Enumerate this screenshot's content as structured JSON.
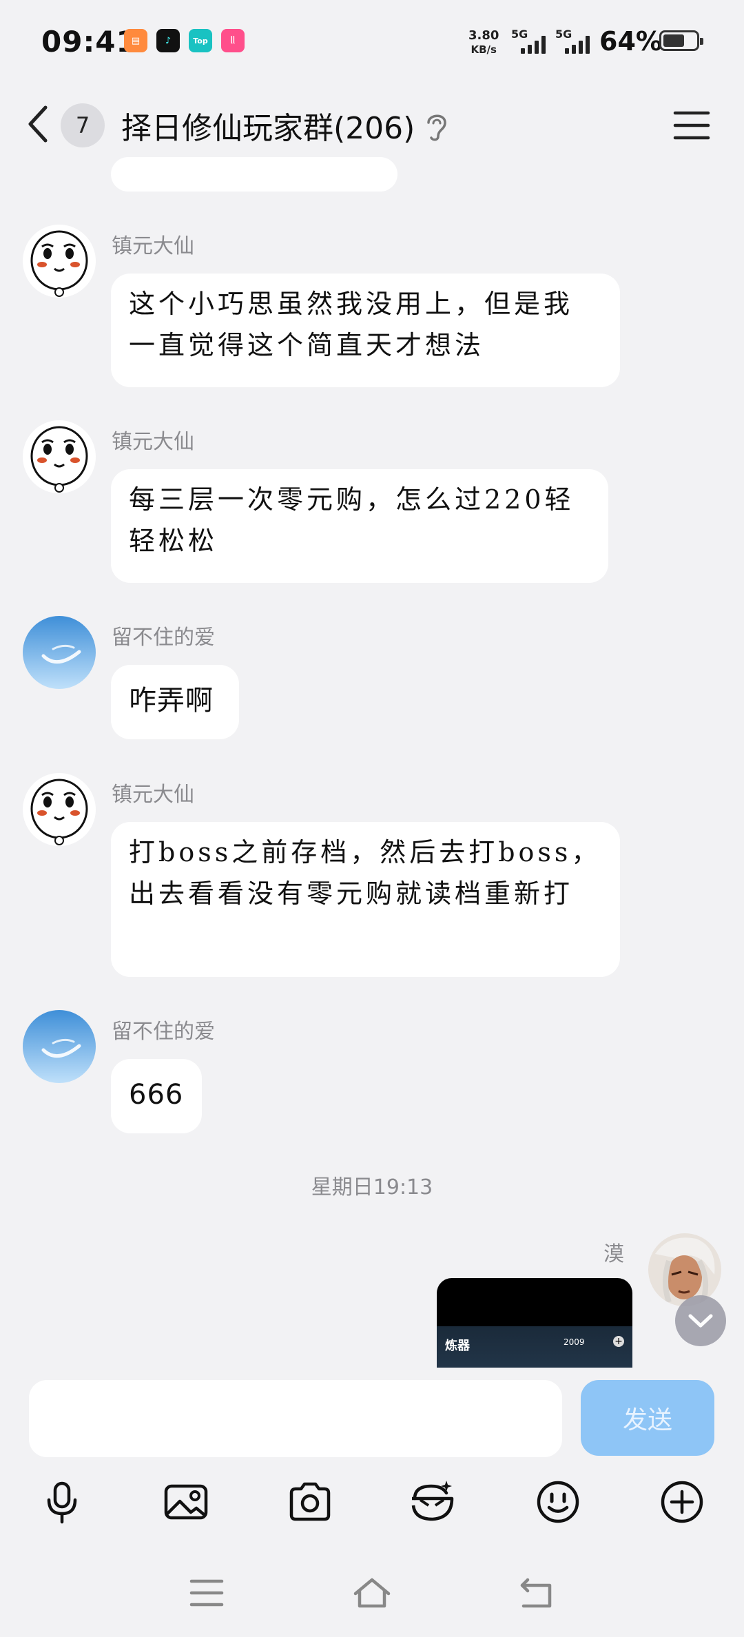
{
  "status_bar": {
    "time": "09:41",
    "apps": [
      {
        "name": "app-icon-orange",
        "color": "#ff8a3d",
        "glyph": "▤"
      },
      {
        "name": "tiktok-icon",
        "color": "#111111",
        "glyph": "♪"
      },
      {
        "name": "top-app-icon",
        "color": "#19c2c2",
        "glyph": "Top"
      },
      {
        "name": "lolla-app-icon",
        "color": "#ff4f8b",
        "glyph": "ᥣᥣ"
      }
    ],
    "net_speed_value": "3.80",
    "net_speed_unit": "KB/s",
    "sim1": "5G",
    "sim2": "5G",
    "battery": "64%",
    "battery_level": 0.64
  },
  "header": {
    "unread_count": "7",
    "title": "择日修仙玩家群(206)"
  },
  "messages": [
    {
      "sender": "镇元大仙",
      "text": "这个小巧思虽然我没用上，但是我一直觉得这个简直天才想法"
    },
    {
      "sender": "镇元大仙",
      "text": "每三层一次零元购，怎么过220轻轻松松"
    },
    {
      "sender": "留不住的爱",
      "text": "咋弄啊"
    },
    {
      "sender": "镇元大仙",
      "text": "打boss之前存档，然后去打boss，出去看看没有零元购就读档重新打"
    },
    {
      "sender": "留不住的爱",
      "text": "666"
    }
  ],
  "time_divider": "星期日19:13",
  "outgoing": {
    "sender": "漠",
    "image_title": "炼器",
    "image_count": "2009"
  },
  "composer": {
    "placeholder": "",
    "send_label": "发送"
  },
  "colors": {
    "accent": "#8ec5f6",
    "background": "#f2f2f4",
    "bubble": "#ffffff"
  }
}
